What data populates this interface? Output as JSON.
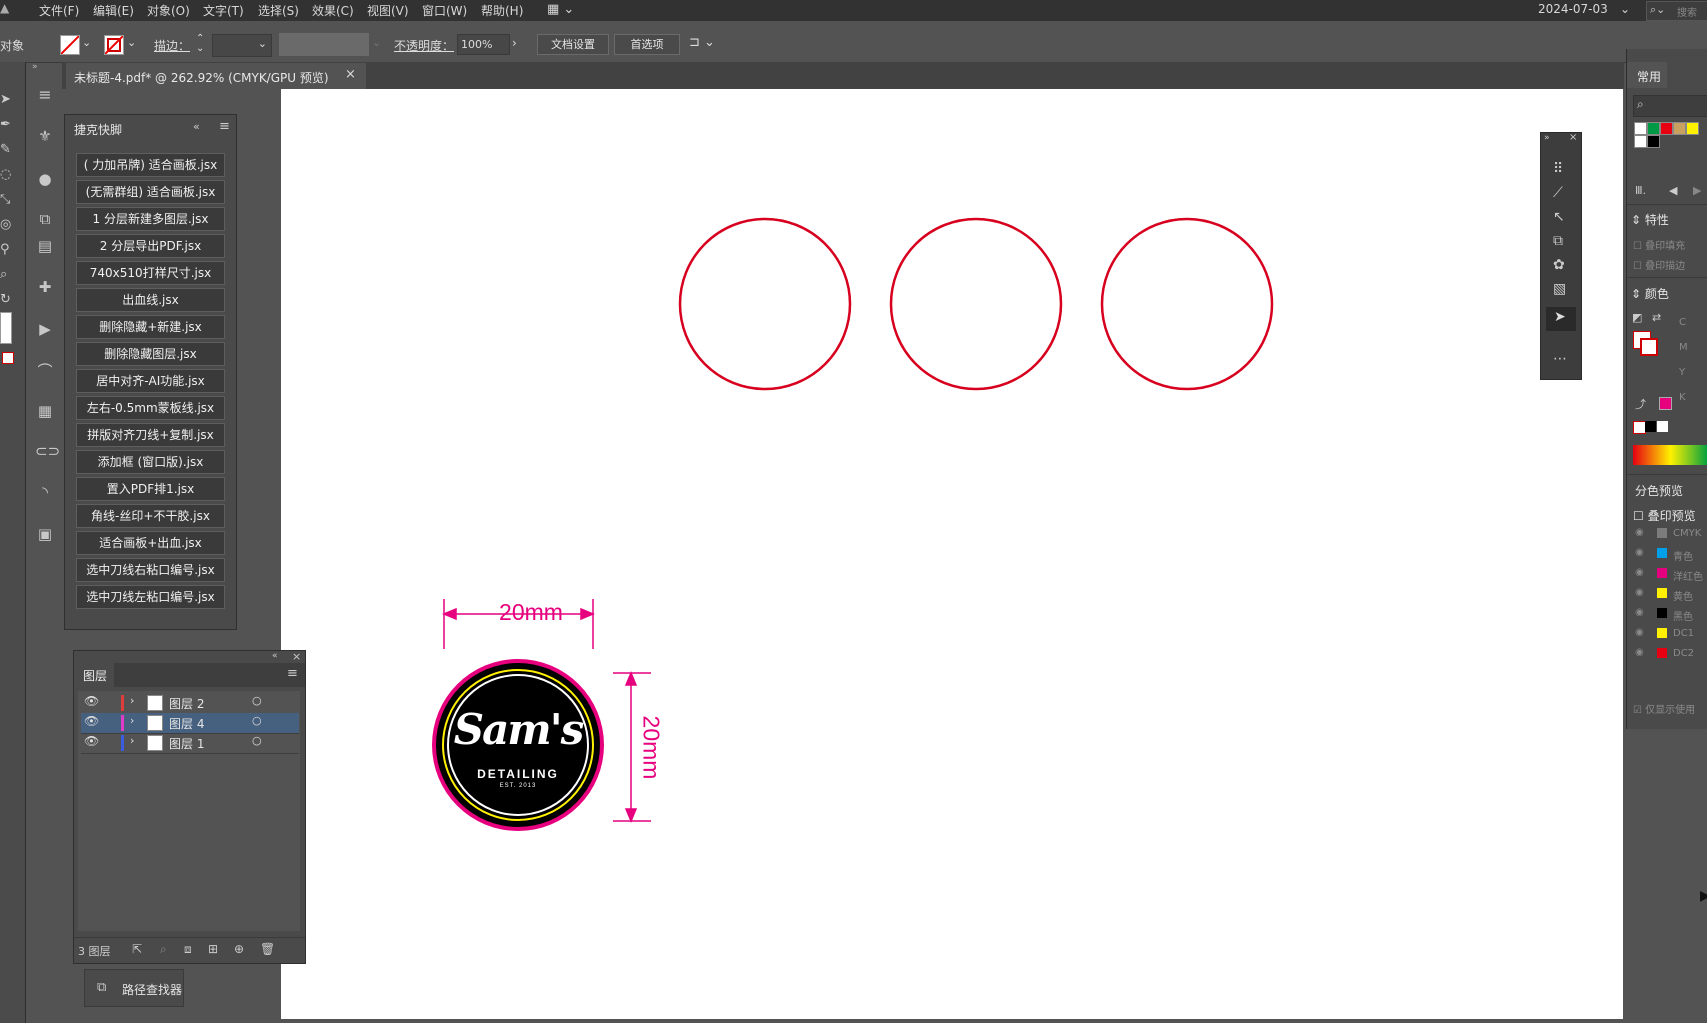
{
  "menubar": {
    "items": [
      "文件(F)",
      "编辑(E)",
      "对象(O)",
      "文字(T)",
      "选择(S)",
      "效果(C)",
      "视图(V)",
      "窗口(W)",
      "帮助(H)"
    ],
    "date": "2024-07-03",
    "search_placeholder": "搜索"
  },
  "control": {
    "left_label": "对象",
    "stroke_label": "描边：",
    "opacity_label": "不透明度：",
    "opacity_value": "100%",
    "doc_settings": "文档设置",
    "preferences": "首选项"
  },
  "document_tab": {
    "title": "未标题-4.pdf* @ 262.92% (CMYK/GPU 预览)",
    "close": "×"
  },
  "shortcuts_panel": {
    "title": "捷克快脚",
    "items": [
      "( 力加吊牌) 适合画板.jsx",
      "(无需群组) 适合画板.jsx",
      "1 分层新建多图层.jsx",
      "2 分层导出PDF.jsx",
      "740x510打样尺寸.jsx",
      "出血线.jsx",
      "删除隐藏+新建.jsx",
      "删除隐藏图层.jsx",
      "居中对齐-AI功能.jsx",
      "左右-0.5mm蒙板线.jsx",
      "拼版对齐刀线+复制.jsx",
      "添加框 (窗口版).jsx",
      "置入PDF排1.jsx",
      "角线-丝印+不干胶.jsx",
      "适合画板+出血.jsx",
      "选中刀线右粘口编号.jsx",
      "选中刀线左粘口编号.jsx"
    ]
  },
  "layers_panel": {
    "title": "图层",
    "layers": [
      {
        "name": "图层 2",
        "color": "#e03c3c",
        "selected": false
      },
      {
        "name": "图层 4",
        "color": "#e03cc8",
        "selected": true
      },
      {
        "name": "图层 1",
        "color": "#3c5ce0",
        "selected": false
      }
    ],
    "count_label": "3 图层"
  },
  "pathfinder": {
    "label": "路径查找器"
  },
  "artwork": {
    "width_dim": "20mm",
    "height_dim": "20mm",
    "logo_main": "Sam's",
    "logo_sub": "DETAILING",
    "logo_est": "EST. 2013",
    "dim_color": "#e6007e",
    "circle_color": "#d7001e"
  },
  "right_panel": {
    "common": "常用",
    "properties": "特性",
    "overprint_fill": "叠印填充",
    "overprint_stroke": "叠印描边",
    "color": "颜色",
    "cmyk_labels": [
      "C",
      "M",
      "Y",
      "K"
    ],
    "sep_preview": "分色预览",
    "overprint_preview": "叠印预览",
    "separations": [
      {
        "name": "CMYK",
        "color": "#7c7c7c"
      },
      {
        "name": "青色",
        "color": "#00a0e9"
      },
      {
        "name": "洋红色",
        "color": "#e4007f"
      },
      {
        "name": "黄色",
        "color": "#fff100"
      },
      {
        "name": "黑色",
        "color": "#000000"
      },
      {
        "name": "DC1",
        "color": "#fff100"
      },
      {
        "name": "DC2",
        "color": "#e60012"
      }
    ],
    "show_used": "仅显示使用"
  }
}
